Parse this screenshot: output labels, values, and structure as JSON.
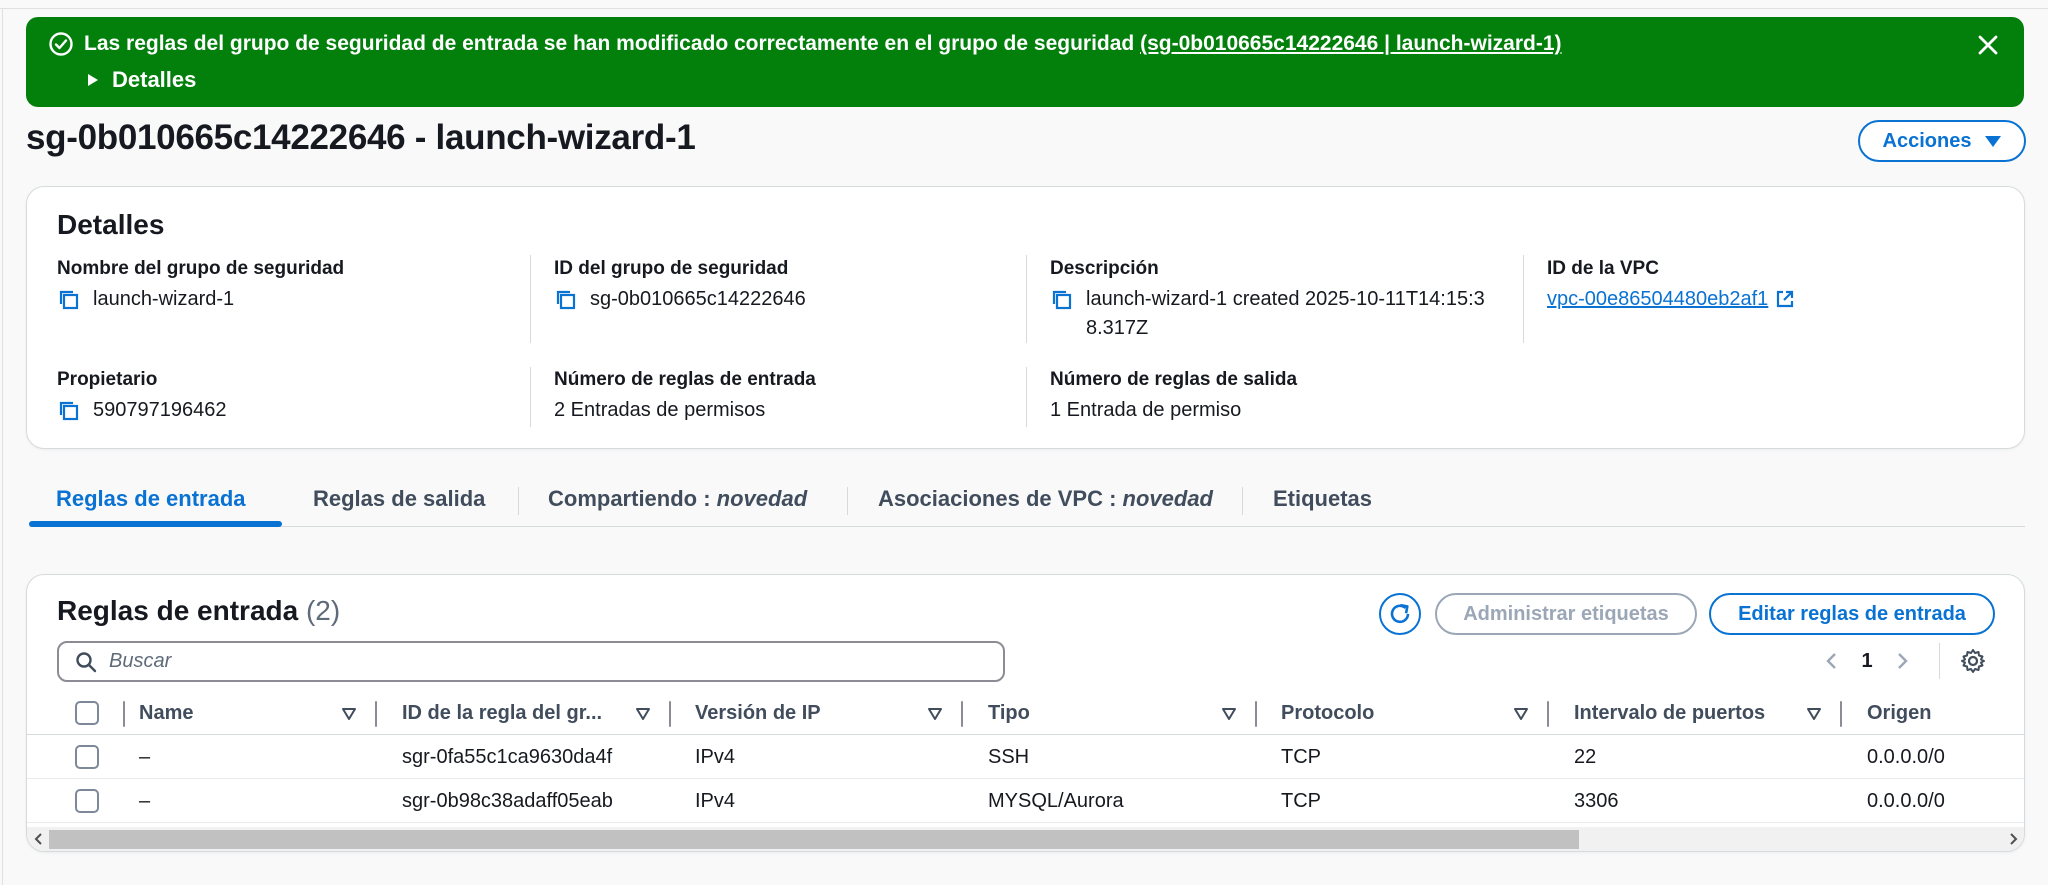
{
  "flash": {
    "message": "Las reglas del grupo de seguridad de entrada se han modificado correctamente en el grupo de seguridad ",
    "link": "(sg-0b010665c14222646 | launch-wizard-1)",
    "details_label": "Detalles"
  },
  "header": {
    "title": "sg-0b010665c14222646 - launch-wizard-1",
    "actions_label": "Acciones"
  },
  "details": {
    "heading": "Detalles",
    "sg_name_label": "Nombre del grupo de seguridad",
    "sg_name_value": "launch-wizard-1",
    "sg_id_label": "ID del grupo de seguridad",
    "sg_id_value": "sg-0b010665c14222646",
    "description_label": "Descripción",
    "description_value": "launch-wizard-1 created 2025-10-11T14:15:38.317Z",
    "vpc_label": "ID de la VPC",
    "vpc_value": "vpc-00e86504480eb2af1",
    "owner_label": "Propietario",
    "owner_value": "590797196462",
    "inbound_count_label": "Número de reglas de entrada",
    "inbound_count_value": "2 Entradas de permisos",
    "outbound_count_label": "Número de reglas de salida",
    "outbound_count_value": "1 Entrada de permiso"
  },
  "tabs": [
    {
      "label": "Reglas de entrada",
      "suffix": ""
    },
    {
      "label": "Reglas de salida",
      "suffix": ""
    },
    {
      "label": "Compartiendo : ",
      "suffix": "novedad"
    },
    {
      "label": "Asociaciones de VPC : ",
      "suffix": "novedad"
    },
    {
      "label": "Etiquetas",
      "suffix": ""
    }
  ],
  "rules": {
    "title": "Reglas de entrada",
    "count": "(2)",
    "manage_tags_label": "Administrar etiquetas",
    "edit_rules_label": "Editar reglas de entrada",
    "search_placeholder": "Buscar",
    "page": "1",
    "columns": [
      "Name",
      "ID de la regla del gr...",
      "Versión de IP",
      "Tipo",
      "Protocolo",
      "Intervalo de puertos",
      "Origen"
    ],
    "rows": [
      {
        "name": "–",
        "rule_id": "sgr-0fa55c1ca9630da4f",
        "ip_version": "IPv4",
        "type": "SSH",
        "protocol": "TCP",
        "port_range": "22",
        "source": "0.0.0.0/0"
      },
      {
        "name": "–",
        "rule_id": "sgr-0b98c38adaff05eab",
        "ip_version": "IPv4",
        "type": "MYSQL/Aurora",
        "protocol": "TCP",
        "port_range": "3306",
        "source": "0.0.0.0/0"
      }
    ]
  },
  "colors": {
    "success": "#037f0c",
    "accent": "#0972d3",
    "text": "#16191f",
    "disabled": "#9ba7b6"
  },
  "icons": [
    "check-circle-icon",
    "caret-right-icon",
    "close-icon",
    "caret-down-icon",
    "copy-icon",
    "external-link-icon",
    "refresh-icon",
    "search-icon",
    "chevron-left-icon",
    "chevron-right-icon",
    "gear-icon",
    "sort-down-icon"
  ]
}
